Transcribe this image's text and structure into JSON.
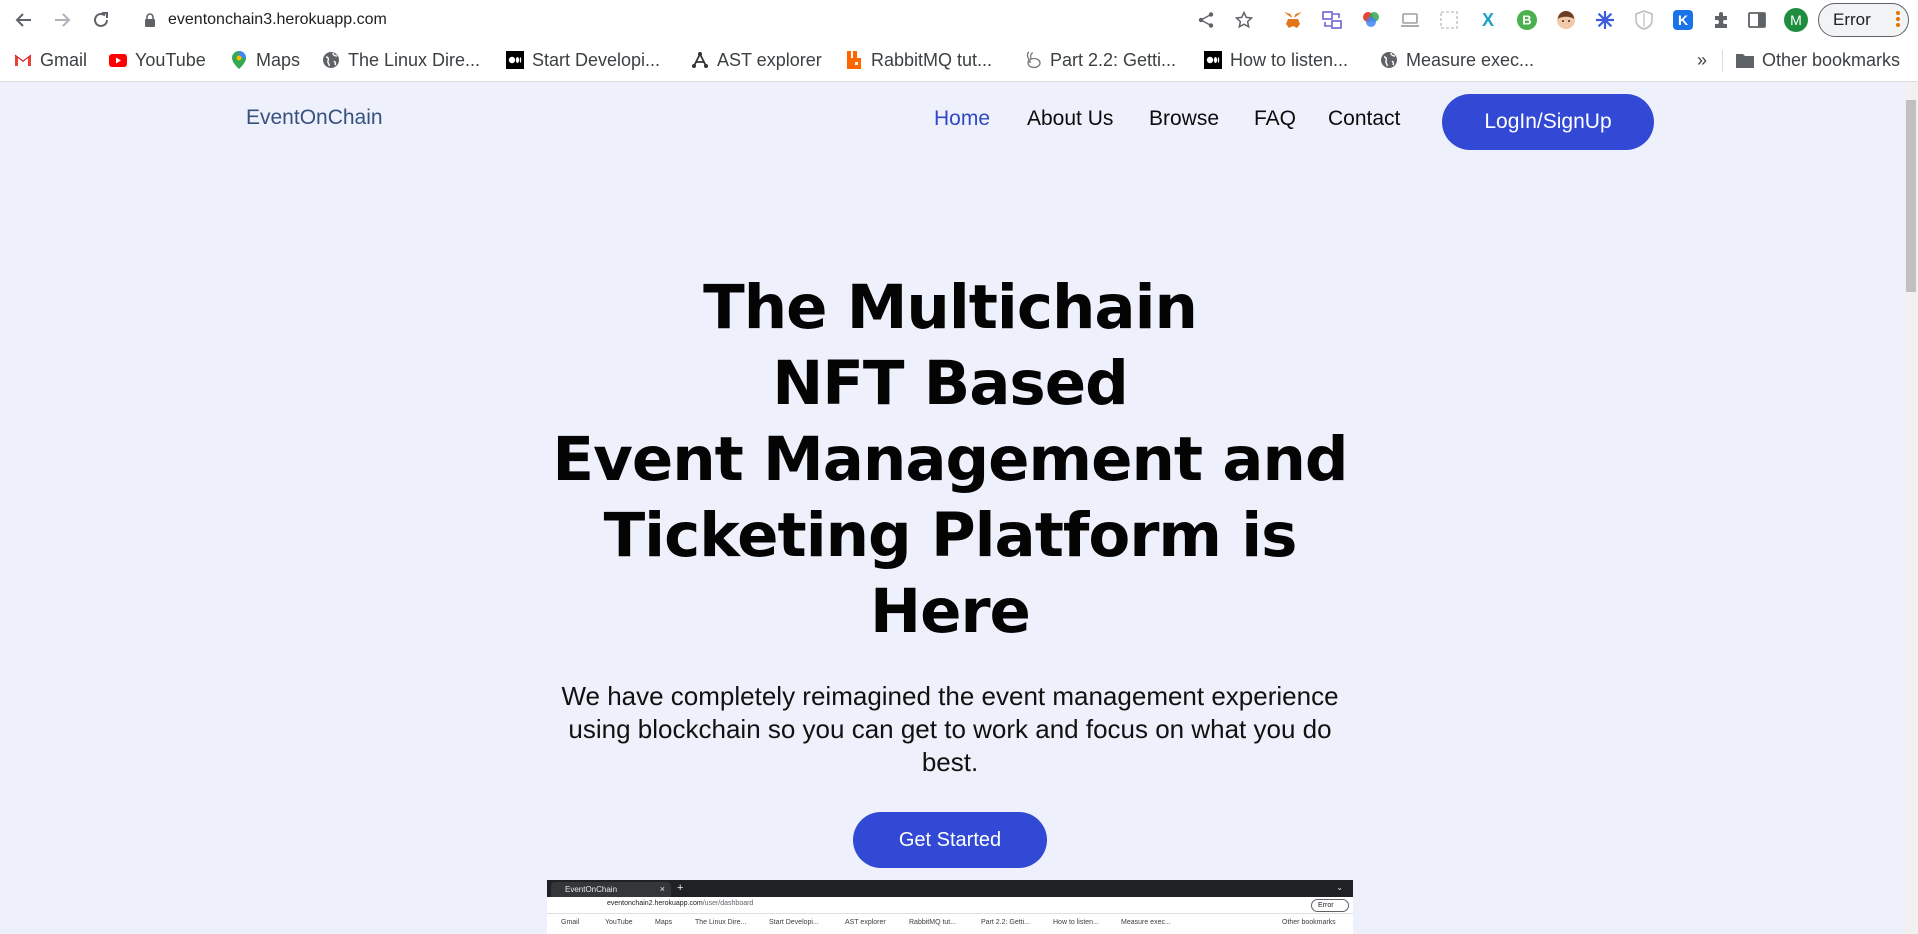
{
  "browser": {
    "url": "eventonchain3.herokuapp.com",
    "error_label": "Error",
    "profile_initial": "M",
    "bookmarks": [
      {
        "label": "Gmail",
        "icon": "gmail-icon"
      },
      {
        "label": "YouTube",
        "icon": "youtube-icon"
      },
      {
        "label": "Maps",
        "icon": "maps-icon"
      },
      {
        "label": "The Linux Dire...",
        "icon": "globe-icon"
      },
      {
        "label": "Start Developi...",
        "icon": "medium-icon"
      },
      {
        "label": "AST explorer",
        "icon": "ast-icon"
      },
      {
        "label": "RabbitMQ tut...",
        "icon": "rabbitmq-icon"
      },
      {
        "label": "Part 2.2: Getti...",
        "icon": "rabbit-icon"
      },
      {
        "label": "How to listen...",
        "icon": "medium-icon"
      },
      {
        "label": "Measure exec...",
        "icon": "globe-icon"
      }
    ],
    "overflow_label": "»",
    "other_bookmarks": "Other bookmarks"
  },
  "site": {
    "brand": "EventOnChain",
    "nav": [
      {
        "label": "Home",
        "active": true
      },
      {
        "label": "About Us",
        "active": false
      },
      {
        "label": "Browse",
        "active": false
      },
      {
        "label": "FAQ",
        "active": false
      },
      {
        "label": "Contact",
        "active": false
      }
    ],
    "login_button": "LogIn/SignUp"
  },
  "hero": {
    "lines": [
      "The Multichain",
      "NFT Based",
      "Event Management and",
      "Ticketing Platform is",
      "Here"
    ],
    "subtitle": "We have completely reimagined the event management experience using blockchain so you can get to work and focus on what you do best.",
    "cta": "Get Started"
  },
  "preview": {
    "tab_title": "EventOnChain",
    "url_host": "eventonchain2.herokuapp.com",
    "url_path": "/user/dashboard",
    "error_label": "Error",
    "bookmarks": [
      "Gmail",
      "YouTube",
      "Maps",
      "The Linux Dire...",
      "Start Developi...",
      "AST explorer",
      "RabbitMQ tut...",
      "Part 2.2: Getti...",
      "How to listen...",
      "Measure exec..."
    ],
    "other_bookmarks": "Other bookmarks"
  },
  "colors": {
    "accent": "#3149d4",
    "page_bg": "#eef1fb",
    "brand_text": "#37517e"
  }
}
